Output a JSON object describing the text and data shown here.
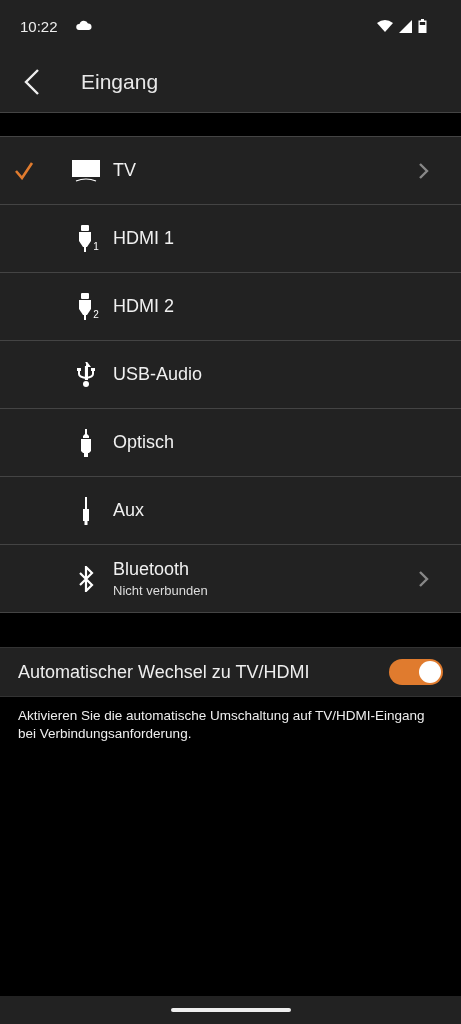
{
  "status_bar": {
    "time": "10:22"
  },
  "app_bar": {
    "title": "Eingang"
  },
  "inputs": [
    {
      "label": "TV",
      "kind": "tv",
      "selected": true,
      "chevron": true
    },
    {
      "label": "HDMI 1",
      "kind": "hdmi",
      "icon_badge": "1",
      "selected": false,
      "chevron": false
    },
    {
      "label": "HDMI 2",
      "kind": "hdmi",
      "icon_badge": "2",
      "selected": false,
      "chevron": false
    },
    {
      "label": "USB-Audio",
      "kind": "usb",
      "selected": false,
      "chevron": false
    },
    {
      "label": "Optisch",
      "kind": "optical",
      "selected": false,
      "chevron": false
    },
    {
      "label": "Aux",
      "kind": "aux",
      "selected": false,
      "chevron": false
    },
    {
      "label": "Bluetooth",
      "subtitle": "Nicht verbunden",
      "kind": "bluetooth",
      "selected": false,
      "chevron": true
    }
  ],
  "auto_switch": {
    "label": "Automatischer Wechsel zu TV/HDMI",
    "on": true,
    "description": "Aktivieren Sie die automatische Umschaltung auf TV/HDMI-Eingang bei Verbindungsanforderung."
  }
}
